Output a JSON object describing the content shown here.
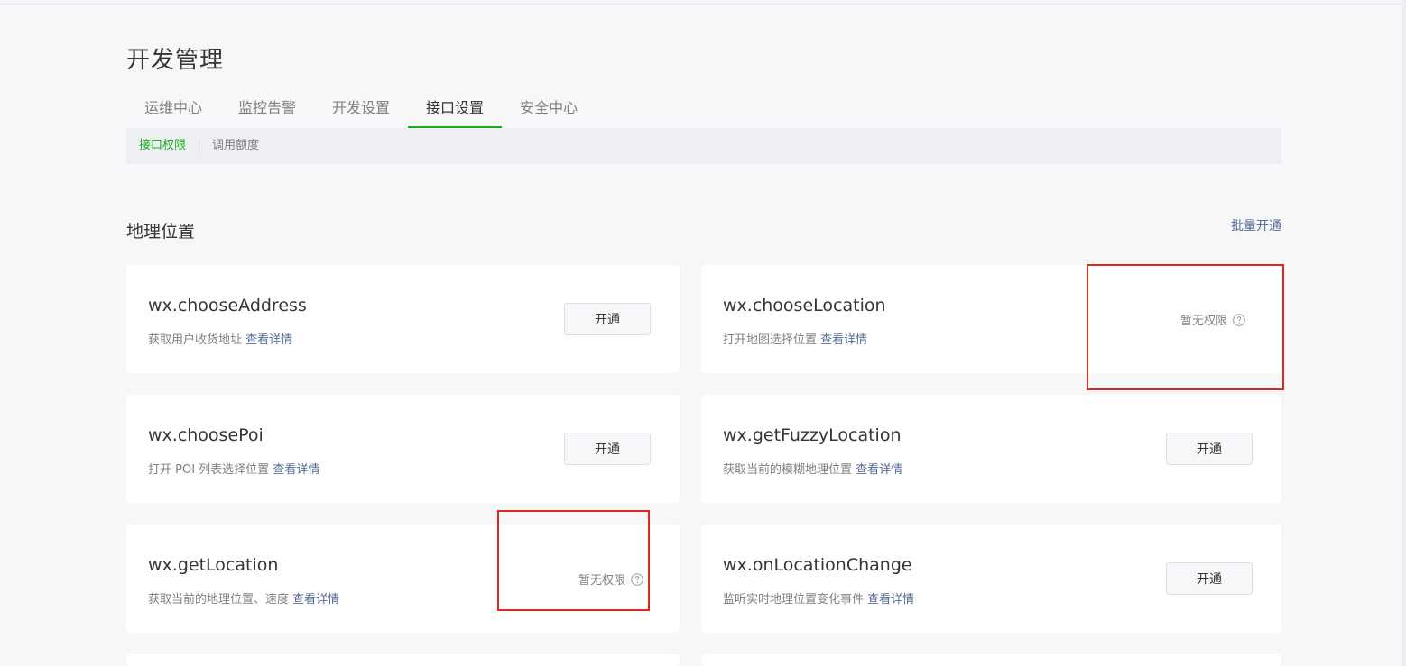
{
  "page": {
    "title": "开发管理"
  },
  "tabs": [
    {
      "label": "运维中心",
      "active": false
    },
    {
      "label": "监控告警",
      "active": false
    },
    {
      "label": "开发设置",
      "active": false
    },
    {
      "label": "接口设置",
      "active": true
    },
    {
      "label": "安全中心",
      "active": false
    }
  ],
  "subtabs": [
    {
      "label": "接口权限",
      "active": true
    },
    {
      "label": "调用额度",
      "active": false
    }
  ],
  "section": {
    "title": "地理位置",
    "batch_label": "批量开通"
  },
  "common": {
    "open_label": "开通",
    "no_permission_label": "暂无权限",
    "detail_link_label": "查看详情"
  },
  "apis": [
    {
      "name": "wx.chooseAddress",
      "desc": "获取用户收货地址",
      "status": "open"
    },
    {
      "name": "wx.chooseLocation",
      "desc": "打开地图选择位置",
      "status": "no-permission"
    },
    {
      "name": "wx.choosePoi",
      "desc": "打开 POI 列表选择位置",
      "status": "open"
    },
    {
      "name": "wx.getFuzzyLocation",
      "desc": "获取当前的模糊地理位置",
      "status": "open"
    },
    {
      "name": "wx.getLocation",
      "desc": "获取当前的地理位置、速度",
      "status": "no-permission"
    },
    {
      "name": "wx.onLocationChange",
      "desc": "监听实时地理位置变化事件",
      "status": "open"
    }
  ],
  "colors": {
    "accent_green": "#1aad19",
    "link_blue": "#576b95",
    "highlight_red": "#e0271f",
    "background": "#f6f7f9"
  },
  "icons": {
    "help": "question-circle-icon"
  }
}
